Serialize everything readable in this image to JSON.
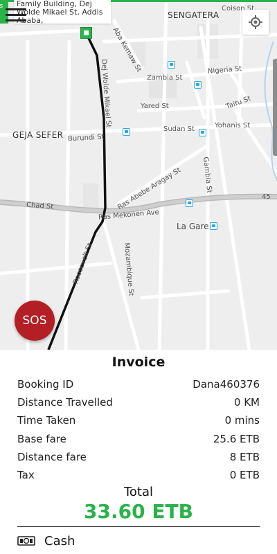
{
  "pickup_address": "Family Building, Dej Wolde Mikael St, Addis Ababa,",
  "top_tab_text": "ls",
  "map": {
    "areas": [
      "SENGATERA",
      "GEJA SEFER"
    ],
    "places": [
      "La Gare"
    ],
    "streets": {
      "coison": "Coison St",
      "aba_kemaw": "Aba Kemaw St",
      "dej_wolde_mikael": "Dej Wolde Mikael St",
      "zambia": "Zambia St",
      "nigeria": "Nigeria St",
      "yared": "Yared St",
      "taitu": "Taitu St",
      "sudan": "Sudan St",
      "yohanis": "Yohanis St",
      "burundi": "Burundi St",
      "ras_abebe": "Ras Abebe Aragay St",
      "gambia": "Gambia St",
      "chad": "Chad St",
      "ras_mekonen": "Ras Mekonen Ave",
      "mozambique": "Mozambique St",
      "roosevelt": "Roosevelt St",
      "route_45": "45"
    }
  },
  "sos_label": "SOS",
  "icons": {
    "menu": "menu-icon",
    "locate": "crosshair-icon",
    "cash": "cash-icon"
  },
  "colors": {
    "brand_green": "#29b34a",
    "sos_red": "#b31f24",
    "route": "#111111",
    "station_blue": "#29a8e0"
  },
  "invoice": {
    "title": "Invoice",
    "rows": [
      {
        "label": "Booking ID",
        "value": "Dana460376"
      },
      {
        "label": "Distance Travelled",
        "value": "0 KM"
      },
      {
        "label": "Time Taken",
        "value": "0 mins"
      },
      {
        "label": "Base fare",
        "value": "25.6 ETB"
      },
      {
        "label": "Distance fare",
        "value": "8 ETB"
      },
      {
        "label": "Tax",
        "value": "0 ETB"
      }
    ],
    "total_label": "Total",
    "total_value": "33.60 ETB"
  },
  "payment": {
    "method": "Cash"
  }
}
